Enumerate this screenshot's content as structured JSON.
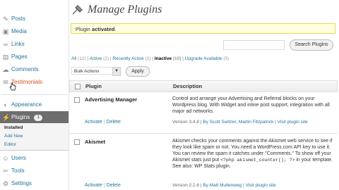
{
  "sidebar": {
    "items": [
      {
        "label": "Posts",
        "icon": "pin-icon"
      },
      {
        "label": "Media",
        "icon": "media-icon"
      },
      {
        "label": "Links",
        "icon": "link-icon"
      },
      {
        "label": "Pages",
        "icon": "page-icon"
      },
      {
        "label": "Comments",
        "icon": "comment-icon"
      },
      {
        "label": "Testimonials",
        "icon": "testimonial-icon"
      }
    ],
    "appearance": "Appearance",
    "plugins": {
      "label": "Plugins",
      "badge": "1"
    },
    "submenu": [
      "Installed",
      "Add New",
      "Editor"
    ],
    "bottom": [
      {
        "label": "Users",
        "icon": "users-icon"
      },
      {
        "label": "Tools",
        "icon": "tools-icon"
      },
      {
        "label": "Settings",
        "icon": "settings-icon"
      }
    ]
  },
  "header": {
    "title": "Manage Plugins"
  },
  "notice": {
    "prefix": "Plugin ",
    "strong": "activated",
    "suffix": "."
  },
  "search": {
    "button": "Search Plugins",
    "placeholder": ""
  },
  "filters": [
    {
      "label": "All",
      "count": "(12)"
    },
    {
      "label": "Active",
      "count": "(2)"
    },
    {
      "label": "Recently Active",
      "count": "(2)"
    },
    {
      "label": "Inactive",
      "count": "(10)"
    },
    {
      "label": "Upgrade Available",
      "count": "(5)"
    }
  ],
  "bulk": {
    "selected": "Bulk Actions",
    "apply": "Apply"
  },
  "table": {
    "columns": {
      "plugin": "Plugin",
      "description": "Description"
    },
    "rows": [
      {
        "name": "Advertising Manager",
        "actions": {
          "activate": "Activate",
          "sep": "|",
          "delete": "Delete"
        },
        "description": "Control and arrange your Advertising and Referral blocks on your Wordpress blog. With Widget and inline post support, integration with all major ad networks.",
        "version": "Version 3.4.8",
        "by": "By Scott Switzer, Martin Fitzpatrick",
        "visit": "Visit plugin site"
      },
      {
        "name": "Akismet",
        "actions": {
          "activate": "Activate",
          "sep": "|",
          "delete": "Delete"
        },
        "description_1": "Akismet checks your comments against the Akismet web service to see if they look like spam or not. You need a WordPress.com API key to use it. You can review the spam it catches under \"Comments.\" To show off your Akismet stats just put",
        "code": "<?php akismet_counter(); ?>",
        "description_2": "in your template. See also: WP Stats plugin.",
        "version": "Version 2.2.6",
        "by": "By Matt Mullenweg",
        "visit": "Visit plugin site"
      }
    ]
  },
  "colors": {
    "link": "#21759b",
    "notice_bg": "#ffffe0",
    "notice_border": "#e6db55",
    "plugins_head": "#6d6d6d"
  }
}
